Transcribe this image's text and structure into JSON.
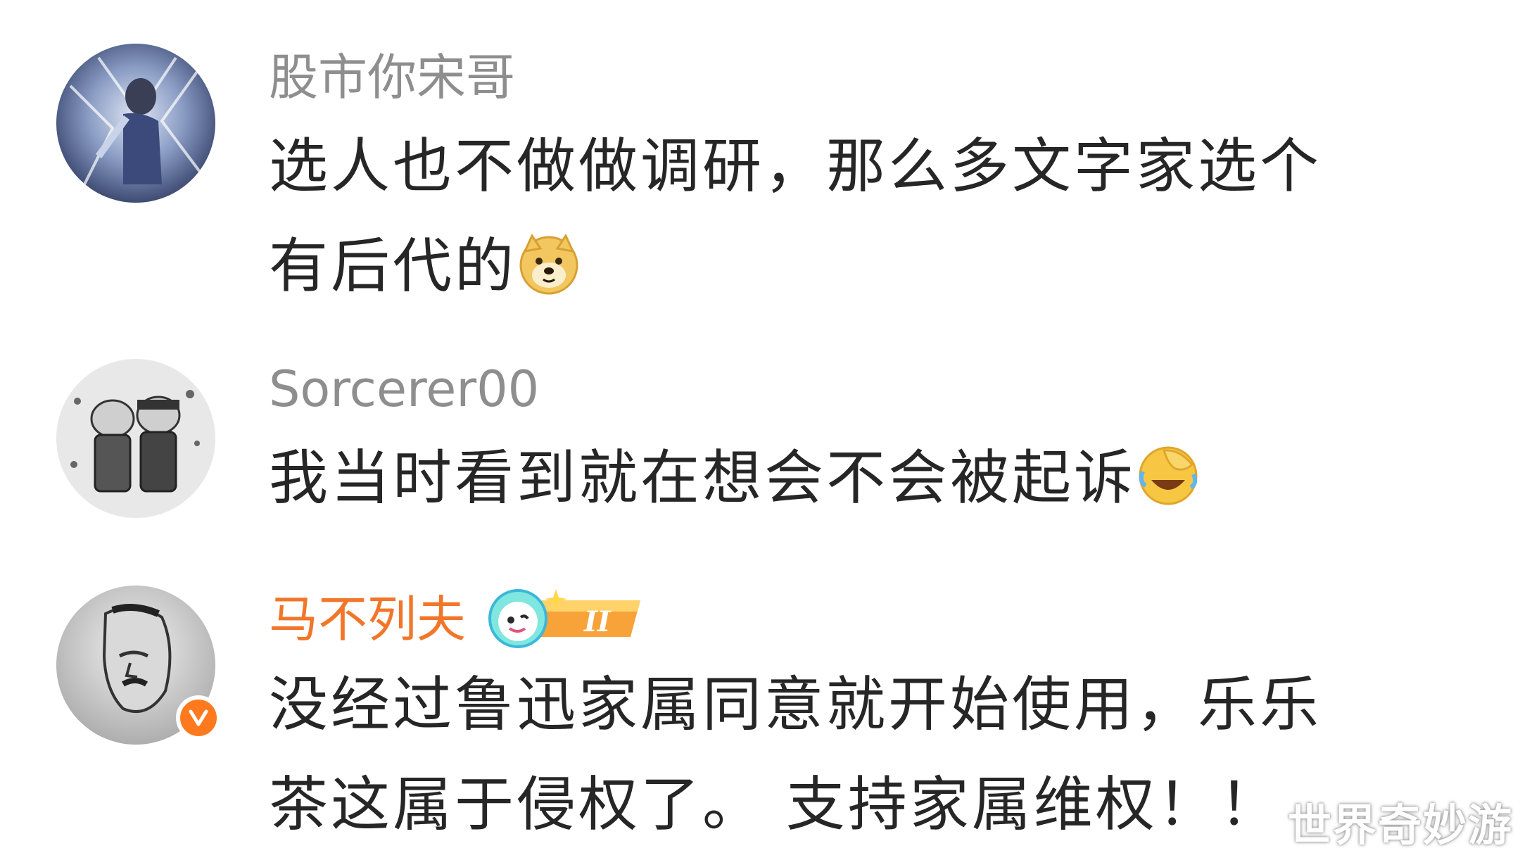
{
  "comments": [
    {
      "username": "股市你宋哥",
      "lines": [
        "选人也不做做调研，那么多文字家选个",
        "有后代的"
      ],
      "emoji": "doge-emoji"
    },
    {
      "username": "Sorcerer00",
      "lines": [
        "我当时看到就在想会不会被起诉"
      ],
      "emoji": "laugh-cry-cover-face-emoji"
    },
    {
      "username": "马不列夫",
      "badge_level": "II",
      "lines": [
        "没经过鲁迅家属同意就开始使用，乐乐",
        "茶这属于侵权了。 支持家属维权！！"
      ],
      "verified": true
    }
  ],
  "watermark": "世界奇妙游",
  "colors": {
    "username_gray": "#8e8e8e",
    "username_orange": "#f2762a",
    "text": "#262626",
    "verified_orange": "#ff7a1f"
  }
}
